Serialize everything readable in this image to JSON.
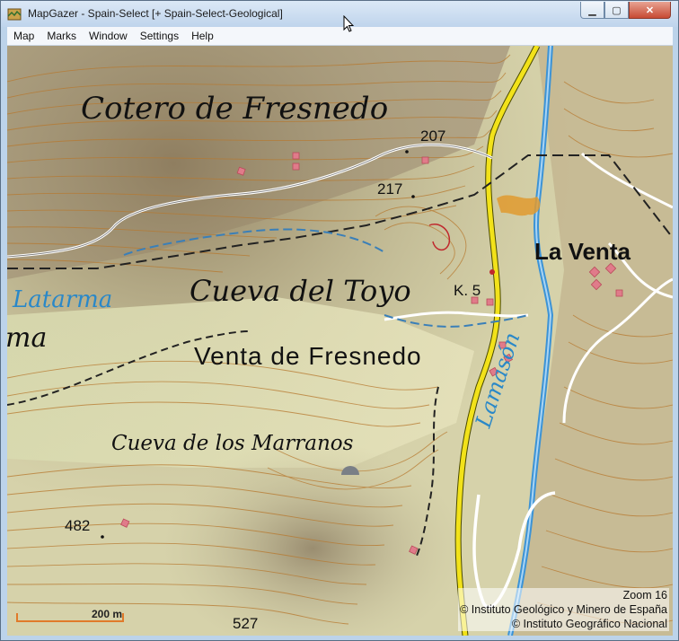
{
  "window": {
    "title": "MapGazer - Spain-Select [+ Spain-Select-Geological]",
    "controls": {
      "minimize": "▁",
      "maximize": "▢",
      "close": "✕"
    }
  },
  "menu": [
    "Map",
    "Marks",
    "Window",
    "Settings",
    "Help"
  ],
  "map": {
    "places": {
      "cotero": "Cotero de Fresnedo",
      "cueva_toyo": "Cueva del Toyo",
      "venta_fresnedo": "Venta de Fresnedo",
      "cueva_marranos": "Cueva de los Marranos",
      "la_venta": "La Venta",
      "km": "K. 5"
    },
    "water": {
      "latarma": "Latarma",
      "ma": "ma",
      "lamason": "Lamasón"
    },
    "elevations": [
      "207",
      "217",
      "482",
      "527"
    ],
    "zoom": "Zoom 16",
    "scale": "200 m",
    "credits": [
      "© Instituto Geológico y Minero de España",
      "© Instituto Geográfico Nacional"
    ]
  }
}
